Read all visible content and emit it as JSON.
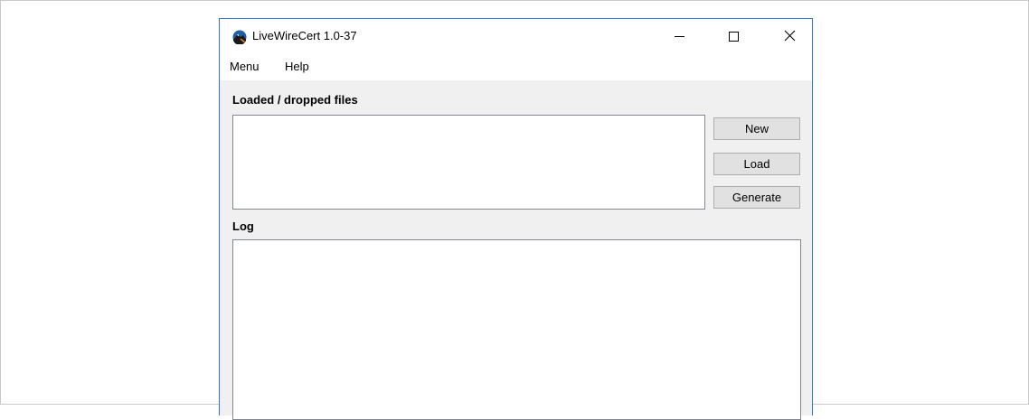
{
  "window": {
    "title": "LiveWireCert 1.0-37",
    "app_icon": "livewirecert-logo-icon",
    "controls": {
      "minimize_icon": "minimize-icon",
      "maximize_icon": "maximize-icon",
      "close_icon": "close-icon"
    }
  },
  "menubar": {
    "items": [
      {
        "label": "Menu"
      },
      {
        "label": "Help"
      }
    ]
  },
  "files_section": {
    "label": "Loaded / dropped files",
    "items": []
  },
  "buttons": {
    "new_label": "New",
    "load_label": "Load",
    "generate_label": "Generate"
  },
  "log_section": {
    "label": "Log",
    "content": ""
  },
  "colors": {
    "window_border": "#2b7bd1",
    "client_background": "#f0f0f0",
    "button_background": "#e1e1e1",
    "field_border": "#828790"
  }
}
